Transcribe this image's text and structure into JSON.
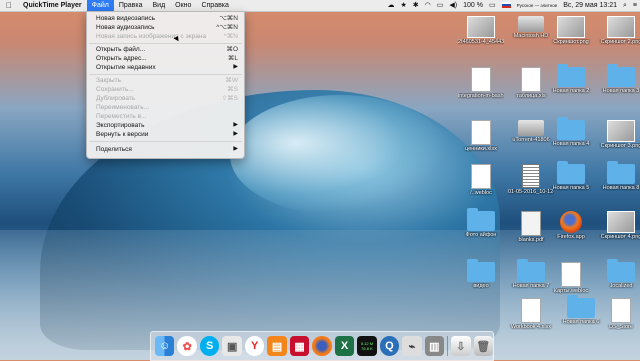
{
  "menubar": {
    "apple": "",
    "app": "QuickTime Player",
    "items": [
      "Файл",
      "Правка",
      "Вид",
      "Окно",
      "Справка"
    ],
    "status": {
      "battery": "100 %",
      "input": "Русское — элитное",
      "datetime": "Вс, 29 мая  13:21"
    }
  },
  "file_menu": [
    {
      "label": "Новая видеозапись",
      "shortcut": "⌥⌘N",
      "enabled": true
    },
    {
      "label": "Новая аудиозапись",
      "shortcut": "^⌥⌘N",
      "enabled": true
    },
    {
      "label": "Новая запись изображения с экрана",
      "shortcut": "^⌘N",
      "enabled": false
    },
    {
      "label": "Открыть файл...",
      "shortcut": "⌘O",
      "enabled": true
    },
    {
      "label": "Открыть адрес...",
      "shortcut": "⌘L",
      "enabled": true
    },
    {
      "label": "Открытие недавних",
      "shortcut": "",
      "enabled": true,
      "submenu": true
    },
    {
      "label": "Закрыть",
      "shortcut": "⌘W",
      "enabled": false
    },
    {
      "label": "Сохранить...",
      "shortcut": "⌘S",
      "enabled": false
    },
    {
      "label": "Дублировать",
      "shortcut": "⇧⌘S",
      "enabled": false
    },
    {
      "label": "Переименовать...",
      "shortcut": "",
      "enabled": false
    },
    {
      "label": "Переместить в...",
      "shortcut": "",
      "enabled": false
    },
    {
      "label": "Экспортировать",
      "shortcut": "",
      "enabled": true,
      "submenu": true
    },
    {
      "label": "Вернуть к версии",
      "shortcut": "",
      "enabled": true,
      "submenu": true
    },
    {
      "label": "Поделиться",
      "shortcut": "",
      "enabled": true,
      "submenu": true
    }
  ],
  "desktop_icons": [
    {
      "label": "2f460531-4_454431-152.jpg",
      "kind": "img"
    },
    {
      "label": "Macintosh HD",
      "kind": "drive"
    },
    {
      "label": "Скриншот.png",
      "kind": "img"
    },
    {
      "label": "Скриншот 2.png",
      "kind": "img"
    },
    {
      "label": "integration-in-bash-out.txt",
      "kind": "doc"
    },
    {
      "label": "таблица.xls",
      "kind": "doc"
    },
    {
      "label": "Новая папка 2",
      "kind": "folder"
    },
    {
      "label": "Новая папка 3",
      "kind": "folder"
    },
    {
      "label": "ценники.xlsx",
      "kind": "doc"
    },
    {
      "label": "uTorrent-41806",
      "kind": "drive"
    },
    {
      "label": "Новая папка 4",
      "kind": "folder"
    },
    {
      "label": "Скриншот 3.png",
      "kind": "img"
    },
    {
      "label": "/..webloc",
      "kind": "doc"
    },
    {
      "label": "01-05-2016_10-12-42.zip",
      "kind": "zip"
    },
    {
      "label": "Новая папка 5",
      "kind": "folder"
    },
    {
      "label": "Новая папка 8",
      "kind": "folder"
    },
    {
      "label": "Фото айфон",
      "kind": "folder"
    },
    {
      "label": "blanks.pdf",
      "kind": "pdf"
    },
    {
      "label": "Firefox.app",
      "kind": "fox"
    },
    {
      "label": "Скриншот 4.png",
      "kind": "img"
    },
    {
      "label": "видео",
      "kind": "folder"
    },
    {
      "label": "Новая папка 7",
      "kind": "folder"
    },
    {
      "label": "Карты.webloc",
      "kind": "doc"
    },
    {
      "label": ".localized",
      "kind": "folder"
    },
    {
      "label": "Workbook 4.xlsx",
      "kind": "doc"
    },
    {
      "label": "Новая папка 6",
      "kind": "folder"
    },
    {
      "label": "DS_Store",
      "kind": "doc"
    }
  ],
  "dock": {
    "apps": [
      "finder",
      "photos",
      "skype",
      "preview",
      "yandex",
      "books",
      "adobe",
      "firefox",
      "excel",
      "activity",
      "quicktime",
      "pcsx",
      "app-store",
      "trash"
    ],
    "activity_values": [
      "5.12 M",
      "76.8 K"
    ]
  }
}
